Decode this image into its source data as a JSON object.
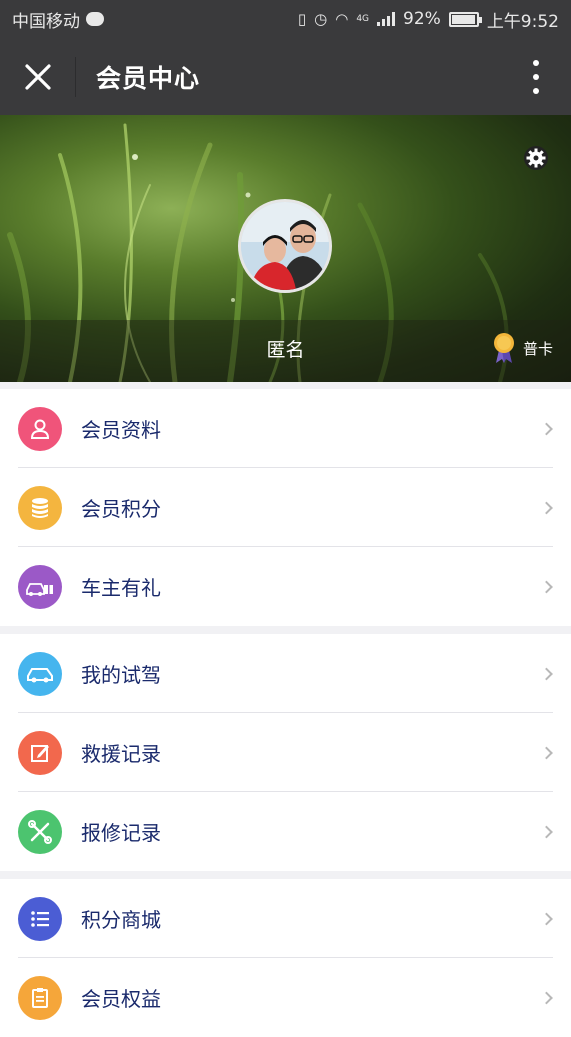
{
  "status_bar": {
    "carrier": "中国移动",
    "network": "4G",
    "battery": "92%",
    "time": "上午9:52"
  },
  "nav": {
    "close_icon": "×",
    "title": "会员中心"
  },
  "profile": {
    "username": "匿名",
    "card_level": "普卡"
  },
  "menu": {
    "groups": [
      {
        "items": [
          {
            "label": "会员资料",
            "icon": "person-icon",
            "color": "#f0547a"
          },
          {
            "label": "会员积分",
            "icon": "coins-icon",
            "color": "#f4b53f"
          },
          {
            "label": "车主有礼",
            "icon": "car-gift-icon",
            "color": "#9b59c7"
          }
        ]
      },
      {
        "items": [
          {
            "label": "我的试驾",
            "icon": "car-icon",
            "color": "#45b5ee"
          },
          {
            "label": "救援记录",
            "icon": "edit-icon",
            "color": "#f2684d"
          },
          {
            "label": "报修记录",
            "icon": "tools-icon",
            "color": "#4cc46f"
          }
        ]
      },
      {
        "items": [
          {
            "label": "积分商城",
            "icon": "list-icon",
            "color": "#4b5dd4"
          },
          {
            "label": "会员权益",
            "icon": "clipboard-icon",
            "color": "#f5a63a"
          }
        ]
      }
    ]
  }
}
